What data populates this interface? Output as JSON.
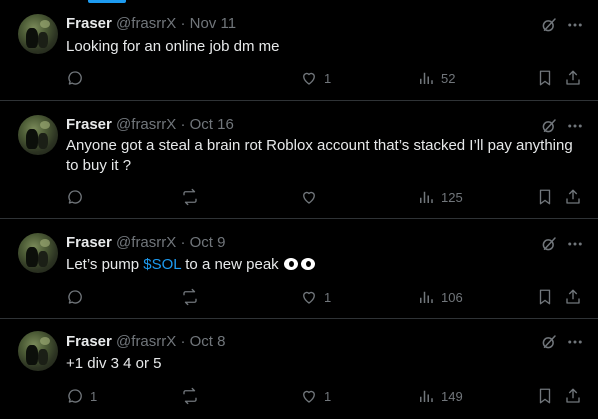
{
  "colors": {
    "background": "#000000",
    "text": "#e7e9ea",
    "muted": "#71767b",
    "accent": "#1d9bf0",
    "divider": "#2f3336"
  },
  "posts": [
    {
      "name": "Fraser",
      "handle": "@frasrrX",
      "separator": "·",
      "date": "Nov 11",
      "text": "Looking for an online job dm me",
      "replies": "",
      "reposts_visible": false,
      "likes": "1",
      "views": "52"
    },
    {
      "name": "Fraser",
      "handle": "@frasrrX",
      "separator": "·",
      "date": "Oct 16",
      "text": "Anyone got a steal a brain rot Roblox account that’s stacked I’ll pay anything to buy it ?",
      "replies": "",
      "reposts": "",
      "likes": "",
      "views": "125"
    },
    {
      "name": "Fraser",
      "handle": "@frasrrX",
      "separator": "·",
      "date": "Oct 9",
      "text_before": "Let’s pump ",
      "cashtag": "$SOL",
      "text_after": " to a new peak",
      "emoji_icons": [
        "eyes-emoji",
        "eyes-emoji"
      ],
      "replies": "",
      "reposts": "",
      "likes": "1",
      "views": "106"
    },
    {
      "name": "Fraser",
      "handle": "@frasrrX",
      "separator": "·",
      "date": "Oct 8",
      "text": "+1 div 3 4 or 5",
      "replies": "1",
      "reposts": "",
      "likes": "1",
      "views": "149"
    }
  ],
  "icons": [
    "reply-icon",
    "repost-icon",
    "like-icon",
    "views-icon",
    "bookmark-icon",
    "share-icon",
    "grok-icon",
    "more-icon"
  ]
}
